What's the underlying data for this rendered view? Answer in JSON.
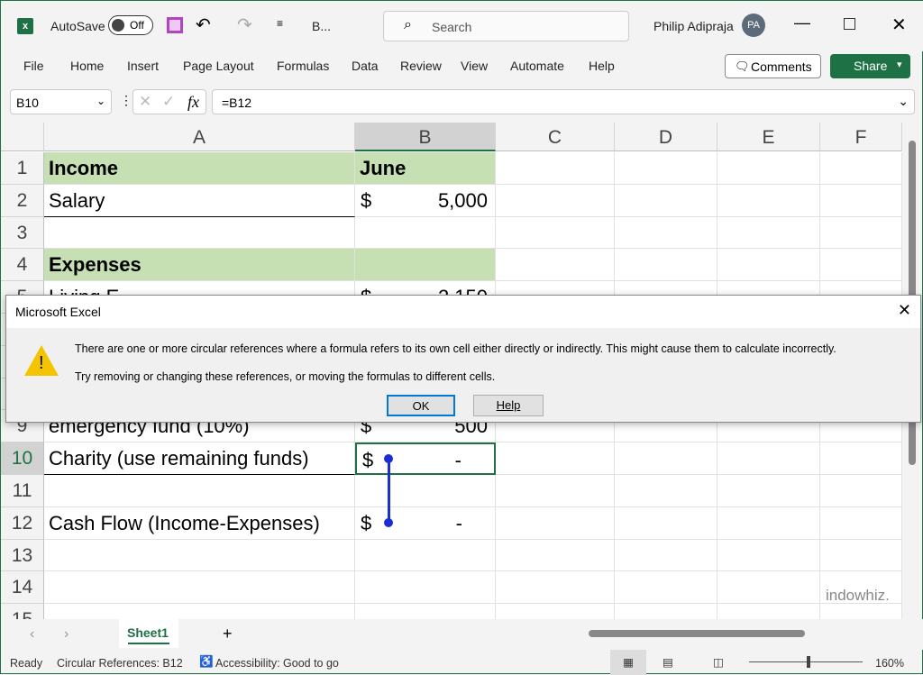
{
  "titlebar": {
    "autosave": "AutoSave",
    "toggle": "Off",
    "filename": "B...",
    "search": "Search",
    "user": "Philip Adipraja",
    "initials": "PA",
    "accent": "#1e7145"
  },
  "ribbon": {
    "tabs": [
      "File",
      "Home",
      "Insert",
      "Page Layout",
      "Formulas",
      "Data",
      "Review",
      "View",
      "Automate",
      "Help"
    ],
    "comments": "Comments",
    "share": "Share"
  },
  "formula_bar": {
    "name_box": "B10",
    "fx": "fx",
    "formula": "=B12"
  },
  "columns": [
    "A",
    "B",
    "C",
    "D",
    "E",
    "F"
  ],
  "rows": [
    {
      "n": "1",
      "a": "Income",
      "cur": "",
      "b": "June",
      "header": true
    },
    {
      "n": "2",
      "a": "Salary",
      "cur": "$",
      "b": "5,000"
    },
    {
      "n": "3",
      "a": "",
      "cur": "",
      "b": ""
    },
    {
      "n": "4",
      "a": "Expenses",
      "cur": "",
      "b": "",
      "header": true
    },
    {
      "n": "5",
      "a": "Living E",
      "cur": "$",
      "b": "2,150"
    },
    {
      "n": "6",
      "a": "",
      "cur": "",
      "b": ""
    },
    {
      "n": "7",
      "a": "",
      "cur": "",
      "b": ""
    },
    {
      "n": "8",
      "a": "",
      "cur": "",
      "b": ""
    },
    {
      "n": "9",
      "a": "emergency fund (10%)",
      "cur": "$",
      "b": "500"
    },
    {
      "n": "10",
      "a": "Charity (use remaining funds)",
      "cur": "$",
      "b": "-"
    },
    {
      "n": "11",
      "a": "",
      "cur": "",
      "b": ""
    },
    {
      "n": "12",
      "a": "Cash Flow (Income-Expenses)",
      "cur": "$",
      "b": "-"
    },
    {
      "n": "13",
      "a": "",
      "cur": "",
      "b": ""
    },
    {
      "n": "14",
      "a": "",
      "cur": "",
      "b": ""
    },
    {
      "n": "15",
      "a": "",
      "cur": "",
      "b": ""
    }
  ],
  "header_fill": "#c6e0b4",
  "dialog": {
    "title": "Microsoft Excel",
    "line1": "There are one or more circular references where a formula refers to its own cell either directly or indirectly. This might cause them to calculate incorrectly.",
    "line2": "Try removing or changing these references, or moving the formulas to different cells.",
    "ok": "OK",
    "help": "Help"
  },
  "sheets": {
    "active": "Sheet1",
    "add": "+"
  },
  "status": {
    "ready": "Ready",
    "circular": "Circular References: B12",
    "accessibility": "Accessibility: Good to go",
    "zoom": "160%"
  },
  "watermark": "indowhiz."
}
